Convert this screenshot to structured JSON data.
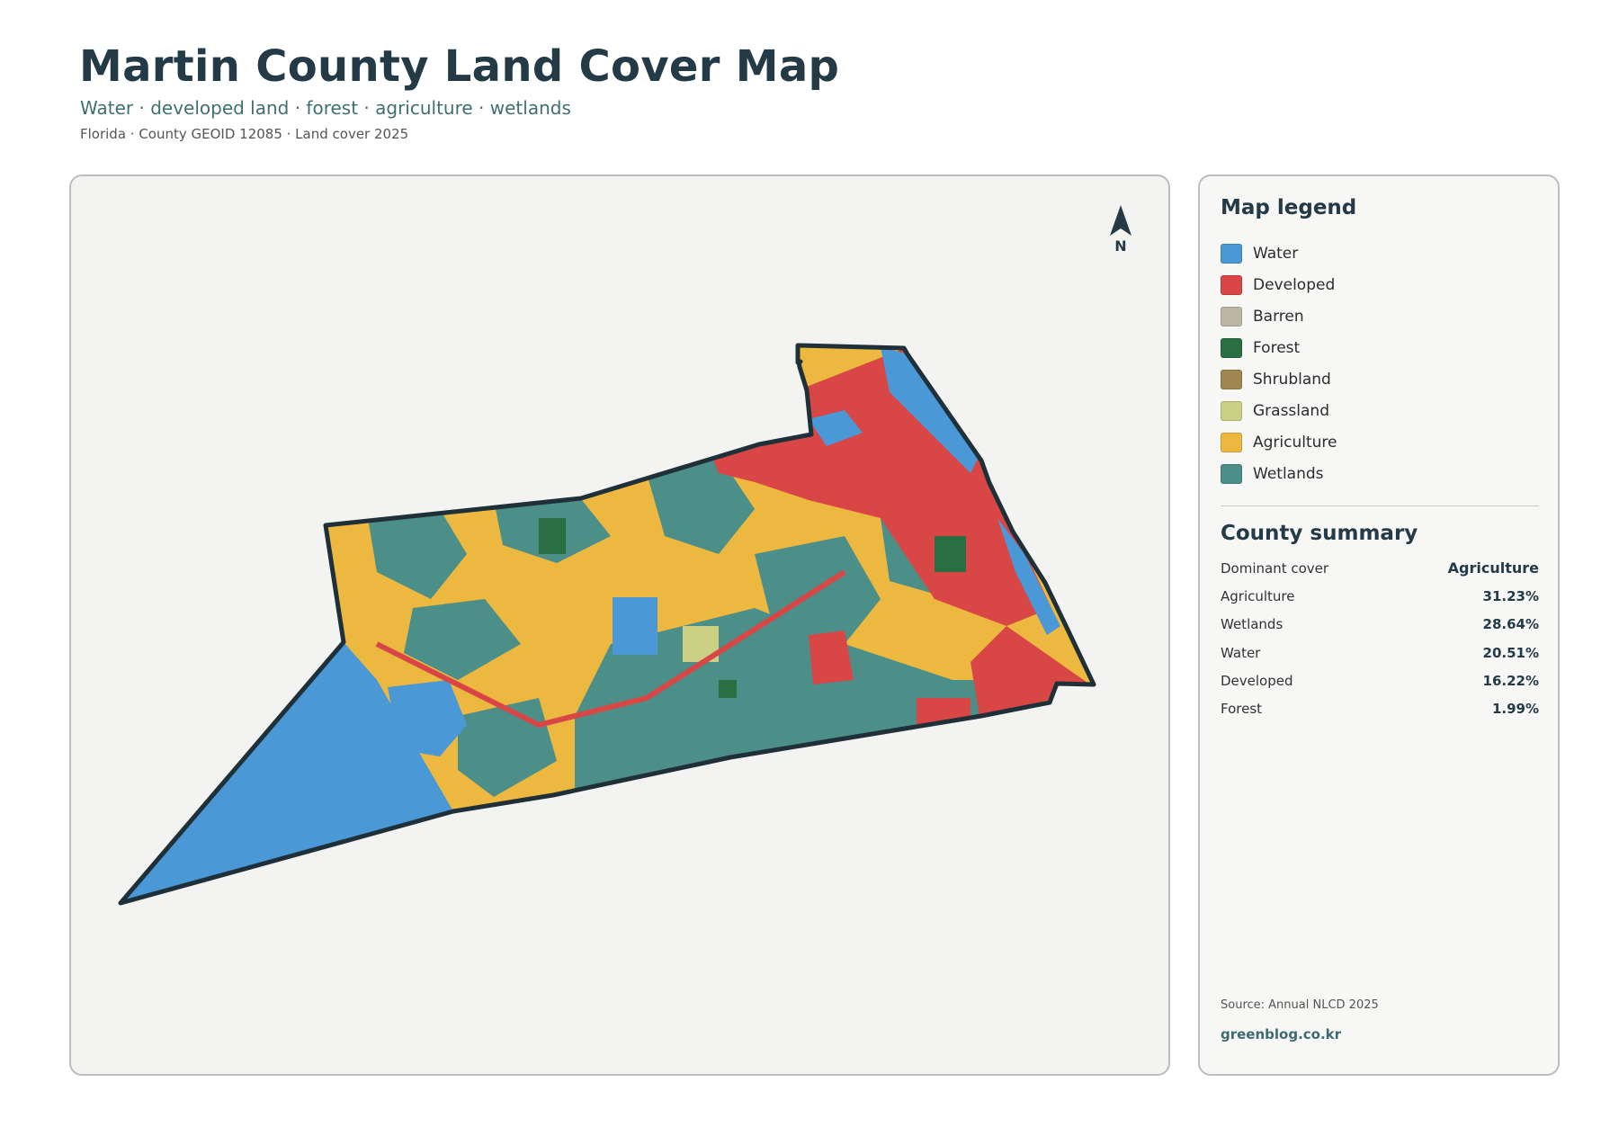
{
  "header": {
    "title": "Martin County Land Cover Map",
    "subtitle": "Water · developed land · forest · agriculture · wetlands",
    "meta": "Florida · County GEOID 12085 · Land cover 2025"
  },
  "map": {
    "north_label": "N",
    "icons": {
      "north_arrow": "north-arrow-icon"
    },
    "outline_color": "#1f3038",
    "background_color": "#f3f3f2"
  },
  "legend": {
    "title": "Map legend",
    "items": [
      {
        "label": "Water",
        "color": "#4a98d6"
      },
      {
        "label": "Developed",
        "color": "#d94646"
      },
      {
        "label": "Barren",
        "color": "#bdb5a3"
      },
      {
        "label": "Forest",
        "color": "#2a6e44"
      },
      {
        "label": "Shrubland",
        "color": "#a08650"
      },
      {
        "label": "Grassland",
        "color": "#ccd084"
      },
      {
        "label": "Agriculture",
        "color": "#ecb840"
      },
      {
        "label": "Wetlands",
        "color": "#4c8e88"
      }
    ]
  },
  "summary": {
    "title": "County summary",
    "rows": [
      {
        "key": "Dominant cover",
        "value": "Agriculture"
      },
      {
        "key": "Agriculture",
        "value": "31.23%"
      },
      {
        "key": "Wetlands",
        "value": "28.64%"
      },
      {
        "key": "Water",
        "value": "20.51%"
      },
      {
        "key": "Developed",
        "value": "16.22%"
      },
      {
        "key": "Forest",
        "value": "1.99%"
      }
    ]
  },
  "footer": {
    "source": "Source: Annual NLCD 2025",
    "site": "greenblog.co.kr"
  }
}
